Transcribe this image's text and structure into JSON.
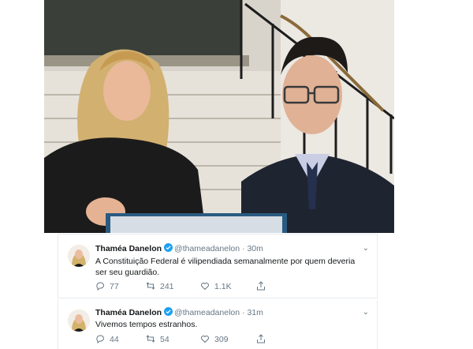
{
  "photo": {
    "description_icon": "photo-image"
  },
  "tweets": [
    {
      "author_name": "Thaméa Danelon",
      "handle": "@thameadanelon",
      "separator": "·",
      "time": "30m",
      "text": "A Constituição Federal é vilipendiada semanalmente por quem deveria ser seu guardião.",
      "replies": "77",
      "retweets": "241",
      "likes": "1.1K"
    },
    {
      "author_name": "Thaméa Danelon",
      "handle": "@thameadanelon",
      "separator": "·",
      "time": "31m",
      "text": "Vivemos tempos estranhos.",
      "replies": "44",
      "retweets": "54",
      "likes": "309"
    }
  ],
  "colors": {
    "verified": "#1da1f2",
    "muted": "#657786",
    "border": "#e6ecf0",
    "text": "#14171a"
  }
}
